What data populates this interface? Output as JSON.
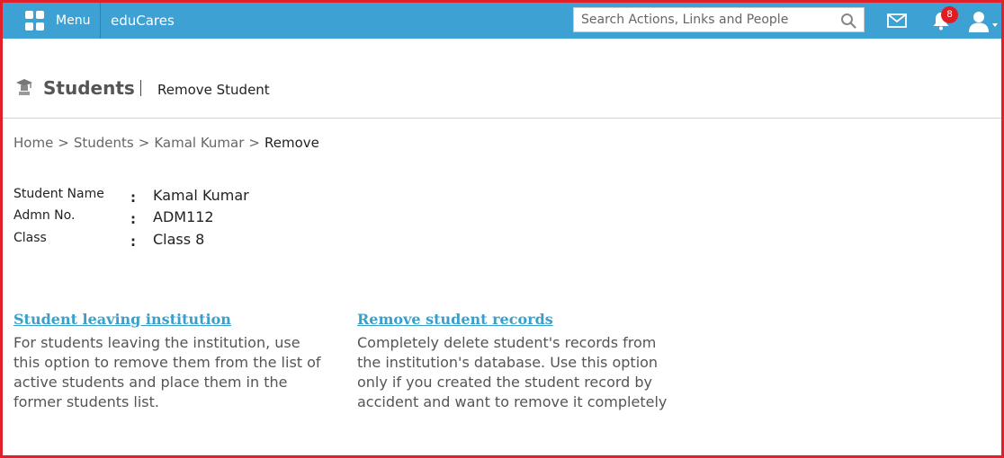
{
  "topbar": {
    "menu_label": "Menu",
    "brand": "eduCares",
    "search_placeholder": "Search Actions, Links and People",
    "notification_count": "8",
    "colors": {
      "bar": "#3ea1d4",
      "badge": "#e21b23"
    }
  },
  "header": {
    "title": "Students",
    "subtitle": "Remove Student"
  },
  "breadcrumb": {
    "items": [
      "Home",
      "Students",
      "Kamal Kumar"
    ],
    "current": "Remove",
    "separator": ">"
  },
  "student": {
    "name_label": "Student Name",
    "name": "Kamal Kumar",
    "admn_label": "Admn No.",
    "admn": "ADM112",
    "class_label": "Class",
    "class": "Class 8",
    "colon": ":"
  },
  "options": {
    "leaving": {
      "link": "Student leaving institution",
      "desc": "For students leaving the institution, use this option to remove them from the list of active students and place them in the former students list."
    },
    "remove": {
      "link": "Remove student records",
      "desc": "Completely delete student's records from the institution's database. Use this option only if you created the student record by accident and want to remove it completely"
    }
  },
  "icons": [
    "grid-icon",
    "search-icon",
    "mail-icon",
    "bell-icon",
    "user-icon",
    "students-icon"
  ]
}
